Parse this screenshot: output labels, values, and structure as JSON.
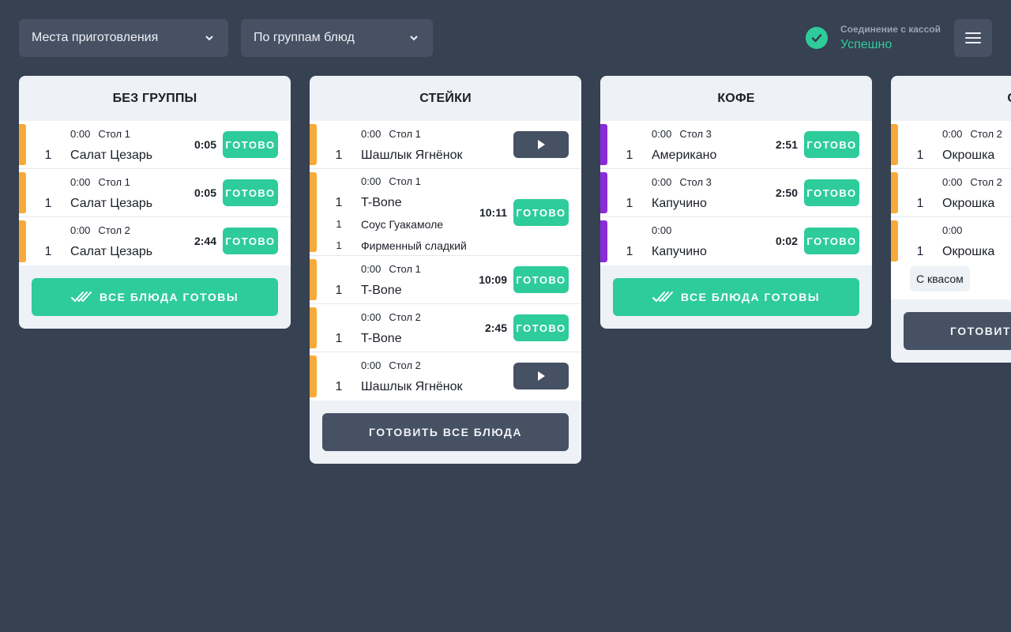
{
  "header": {
    "places_select": "Места приготовления",
    "group_select": "По группам блюд",
    "connection_label": "Соединение с кассой",
    "connection_status": "Успешно"
  },
  "colors": {
    "accent": "#2ecc9a",
    "orange": "#f7aa39",
    "purple": "#8a2bd8",
    "bg": "#364152"
  },
  "ready_label": "ГОТОВО",
  "cards": [
    {
      "title": "БЕЗ ГРУППЫ",
      "footer": "ВСЕ БЛЮДА ГОТОВЫ",
      "rows": [
        {
          "time": "0:00",
          "table": "Стол 1",
          "qty": "1",
          "dish": "Салат Цезарь",
          "timer": "0:05"
        },
        {
          "time": "0:00",
          "table": "Стол 1",
          "qty": "1",
          "dish": "Салат Цезарь",
          "timer": "0:05"
        },
        {
          "time": "0:00",
          "table": "Стол 2",
          "qty": "1",
          "dish": "Салат Цезарь",
          "timer": "2:44"
        }
      ]
    },
    {
      "title": "СТЕЙКИ",
      "footer": "ГОТОВИТЬ ВСЕ БЛЮДА",
      "rows": [
        {
          "time": "0:00",
          "table": "Стол 1",
          "qty": "1",
          "dish": "Шашлык Ягнёнок"
        },
        {
          "time": "0:00",
          "table": "Стол 1",
          "qty": "1",
          "dish": "T-Bone",
          "timer": "10:11",
          "sub": [
            {
              "qty": "1",
              "name": "Соус Гуакамоле"
            },
            {
              "qty": "1",
              "name": "Фирменный сладкий"
            }
          ]
        },
        {
          "time": "0:00",
          "table": "Стол 1",
          "qty": "1",
          "dish": "T-Bone",
          "timer": "10:09"
        },
        {
          "time": "0:00",
          "table": "Стол 2",
          "qty": "1",
          "dish": "T-Bone",
          "timer": "2:45"
        },
        {
          "time": "0:00",
          "table": "Стол 2",
          "qty": "1",
          "dish": "Шашлык Ягнёнок"
        }
      ]
    },
    {
      "title": "КОФЕ",
      "footer": "ВСЕ БЛЮДА ГОТОВЫ",
      "rows": [
        {
          "time": "0:00",
          "table": "Стол 3",
          "qty": "1",
          "dish": "Американо",
          "timer": "2:51"
        },
        {
          "time": "0:00",
          "table": "Стол 3",
          "qty": "1",
          "dish": "Капучино",
          "timer": "2:50"
        },
        {
          "time": "0:00",
          "table": "",
          "qty": "1",
          "dish": "Капучино",
          "timer": "0:02"
        }
      ]
    },
    {
      "title": "СУПЫ",
      "footer": "ГОТОВИТЬ ВСЕ БЛЮДА",
      "rows": [
        {
          "time": "0:00",
          "table": "Стол 2",
          "qty": "1",
          "dish": "Окрошка"
        },
        {
          "time": "0:00",
          "table": "Стол 2",
          "qty": "1",
          "dish": "Окрошка"
        },
        {
          "time": "0:00",
          "table": "",
          "qty": "1",
          "dish": "Окрошка",
          "modifier": "С квасом"
        }
      ]
    }
  ]
}
